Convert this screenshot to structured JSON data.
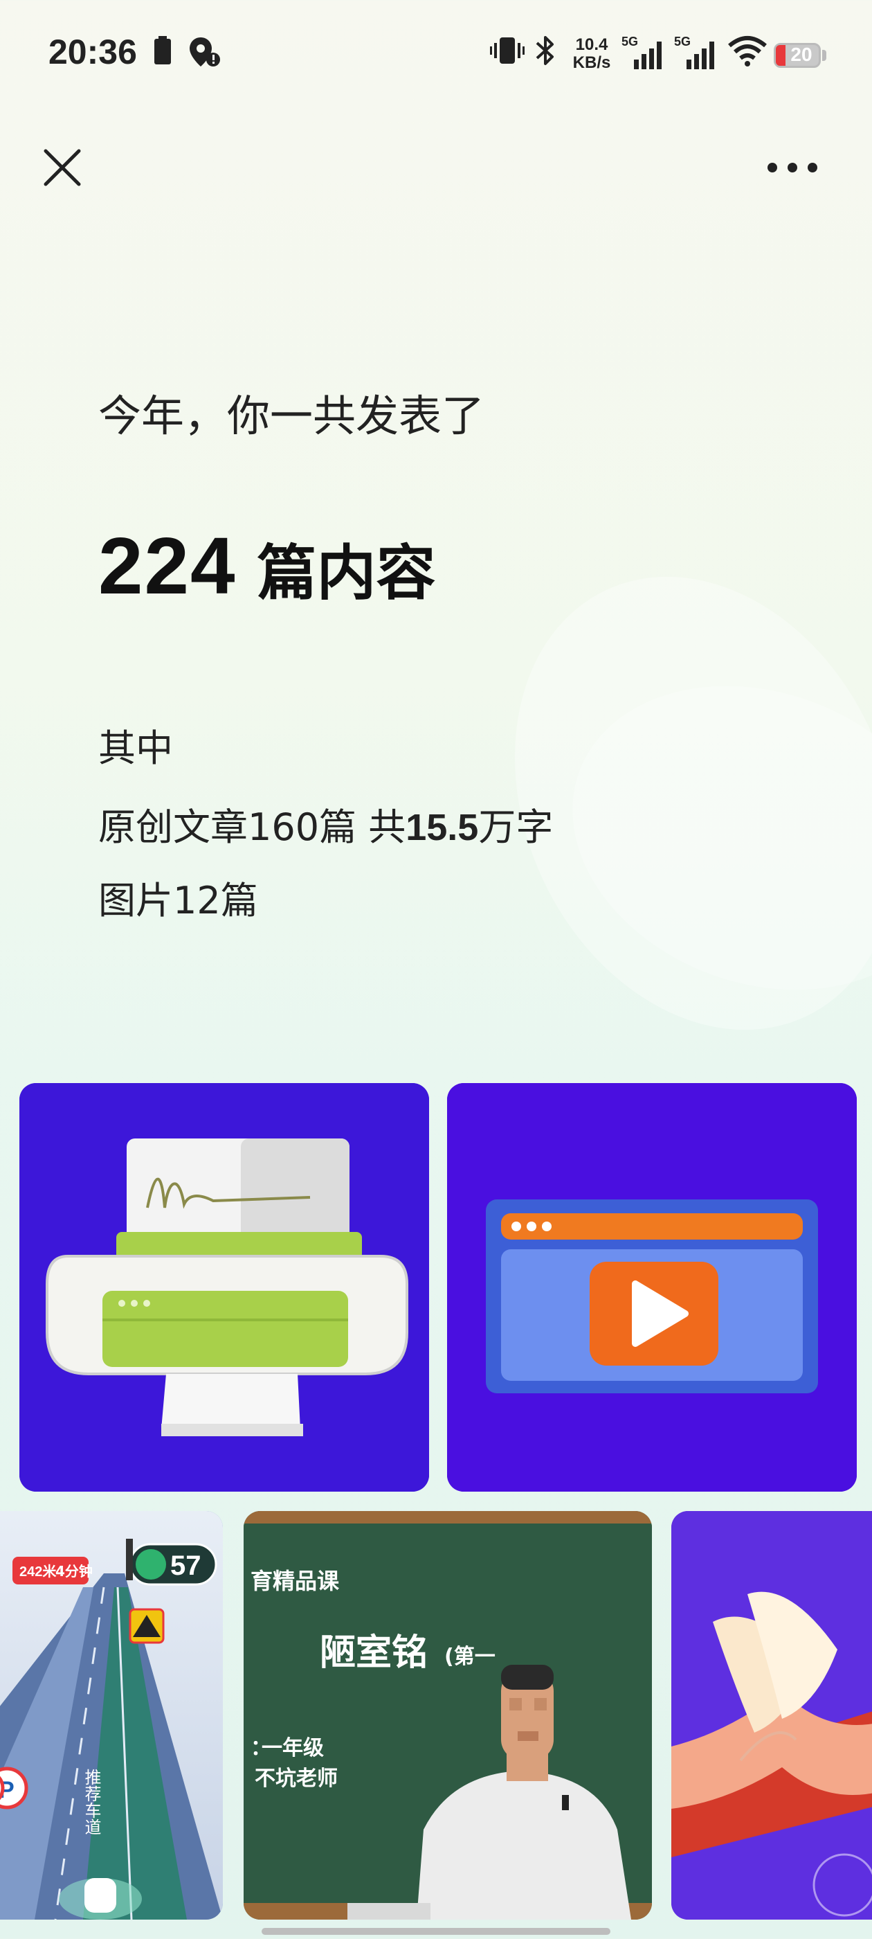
{
  "status_bar": {
    "time": "20:36",
    "net_speed_value": "10.4",
    "net_speed_unit": "KB/s",
    "signal1_label": "5G",
    "signal2_label": "5G",
    "battery_level": "20",
    "icons": [
      "battery-small-icon",
      "location-alert-icon",
      "vibrate-icon",
      "bluetooth-icon",
      "signal-icon",
      "wifi-icon"
    ]
  },
  "header": {
    "close_icon": "close-icon",
    "more_icon": "more-icon"
  },
  "summary": {
    "intro": "今年，你一共发表了",
    "total_count": "224",
    "total_unit": "篇内容",
    "breakdown_label": "其中",
    "original_prefix": "原创文章160篇 共",
    "original_words": "15.5",
    "original_suffix": "万字",
    "images_line": "图片12篇"
  },
  "gallery": {
    "row1": [
      {
        "name": "printer-illustration",
        "bg": "#3d17d9"
      },
      {
        "name": "video-player-illustration",
        "bg": "#4a0fe0"
      }
    ],
    "row2": [
      {
        "name": "navigation-screenshot",
        "bg": "#6f8fc8",
        "texts": [
          "242米",
          "4分钟",
          "57",
          "推荐车道"
        ]
      },
      {
        "name": "chalkboard-lesson",
        "bg": "#2f5a43",
        "texts": [
          "育精品课",
          "陋室铭",
          "(第一",
          "一年级",
          "不坑老师"
        ]
      },
      {
        "name": "book-illustration",
        "bg": "#5e2fe0"
      }
    ]
  },
  "colors": {
    "accent_purple": "#3d17d9",
    "text_dark": "#222222"
  }
}
